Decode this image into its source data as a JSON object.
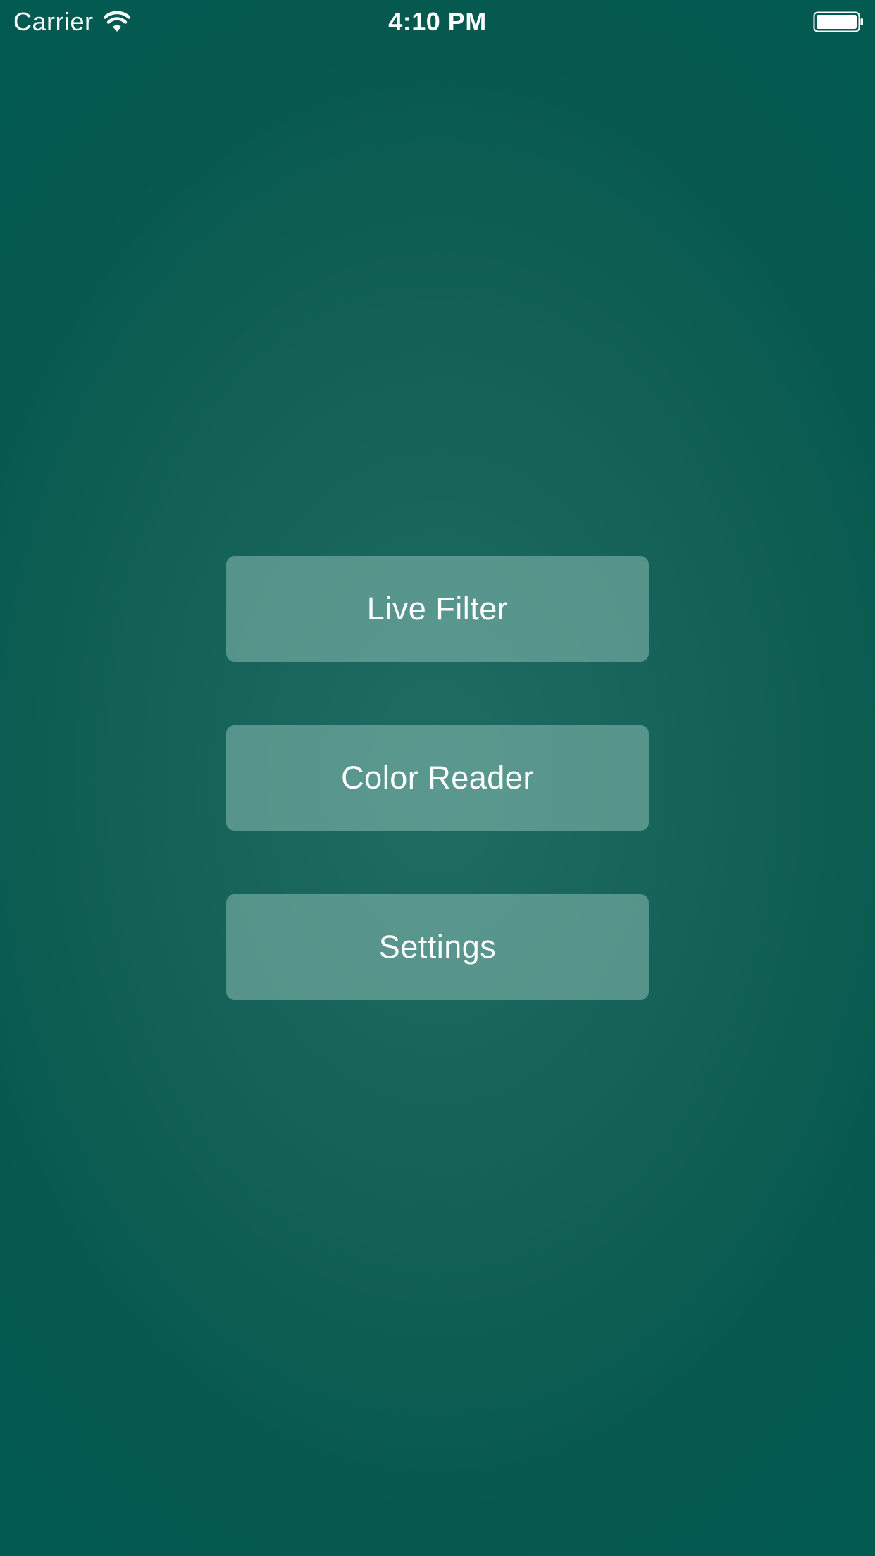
{
  "status_bar": {
    "carrier": "Carrier",
    "time": "4:10 PM",
    "wifi_icon": "wifi-icon",
    "battery_icon": "battery-full-icon"
  },
  "menu": {
    "buttons": [
      {
        "label": "Live Filter"
      },
      {
        "label": "Color Reader"
      },
      {
        "label": "Settings"
      }
    ]
  },
  "colors": {
    "background_center": "#1f6c63",
    "background_edge": "#035a50",
    "button_fill": "#5a958c",
    "text": "#ffffff"
  }
}
